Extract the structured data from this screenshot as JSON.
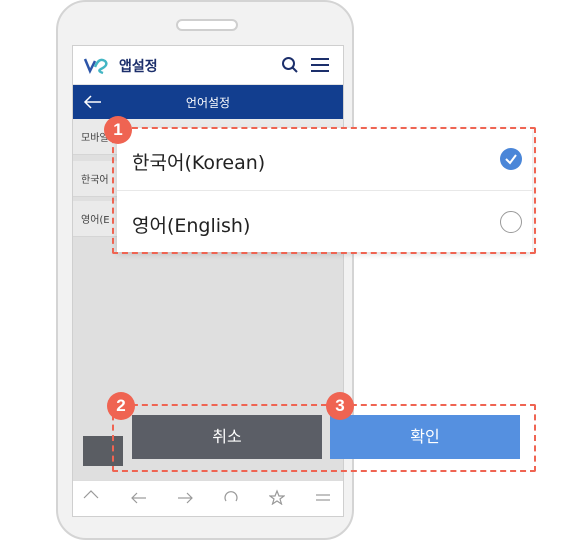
{
  "app": {
    "title": "앱설정"
  },
  "subheader": {
    "title": "언어설정"
  },
  "background_rows": [
    {
      "label": "모바일"
    },
    {
      "label": "한국어"
    },
    {
      "label": "영어(E"
    }
  ],
  "language_options": [
    {
      "label": "한국어(Korean)",
      "selected": true
    },
    {
      "label": "영어(English)",
      "selected": false
    }
  ],
  "buttons": {
    "cancel": "취소",
    "confirm": "확인"
  },
  "badges": [
    "1",
    "2",
    "3"
  ],
  "colors": {
    "accent": "#ef6452",
    "header": "#123e8f",
    "confirm": "#5590e0",
    "cancel": "#5b5e66"
  },
  "icons": [
    "logo-icon",
    "search-icon",
    "menu-icon",
    "back-icon",
    "check-icon",
    "home-icon",
    "arrow-left-icon",
    "arrow-right-icon",
    "refresh-icon",
    "star-icon",
    "menu-icon"
  ]
}
